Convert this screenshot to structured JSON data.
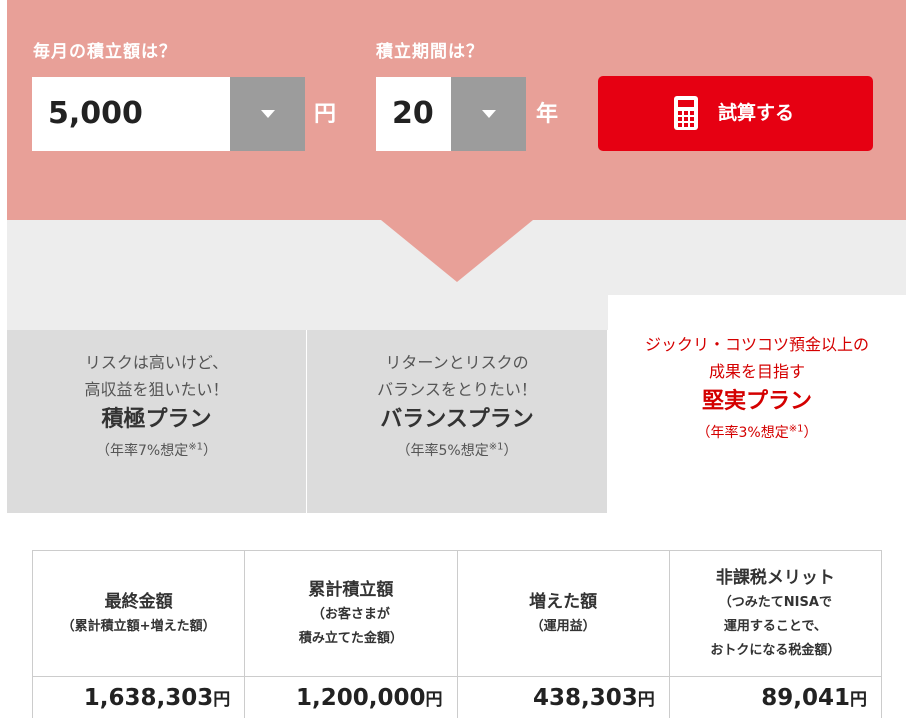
{
  "form": {
    "monthly_label": "毎月の積立額は？",
    "monthly_value": "5,000",
    "monthly_unit": "円",
    "period_label": "積立期間は？",
    "period_value": "20",
    "period_unit": "年",
    "calc_button": "試算する"
  },
  "plans": [
    {
      "desc1": "リスクは高いけど、",
      "desc2": "高収益を狙いたい！",
      "name": "積極プラン",
      "rate": "（年率7%想定",
      "note": "※1",
      "close": "）",
      "active": false
    },
    {
      "desc1": "リターンとリスクの",
      "desc2": "バランスをとりたい！",
      "name": "バランスプラン",
      "rate": "（年率5%想定",
      "note": "※1",
      "close": "）",
      "active": false
    },
    {
      "desc1": "ジックリ・コツコツ預金以上の",
      "desc2": "成果を目指す",
      "name": "堅実プラン",
      "rate": "（年率3%想定",
      "note": "※1",
      "close": "）",
      "active": true
    }
  ],
  "results": {
    "headers": [
      {
        "main": "最終金額",
        "sub": [
          "（累計積立額+増えた額）"
        ]
      },
      {
        "main": "累計積立額",
        "sub": [
          "（お客さまが",
          "積み立てた金額）"
        ]
      },
      {
        "main": "増えた額",
        "sub": [
          "（運用益）"
        ]
      },
      {
        "main": "非課税メリット",
        "sub": [
          "（つみたてNISAで",
          "運用することで、",
          "おトクになる税金額）"
        ]
      }
    ],
    "values": [
      "1,638,303",
      "1,200,000",
      "438,303",
      "89,041"
    ],
    "currency": "円"
  },
  "colors": {
    "header_bg": "#e8a098",
    "accent": "#e60012",
    "active_text": "#d40000"
  }
}
